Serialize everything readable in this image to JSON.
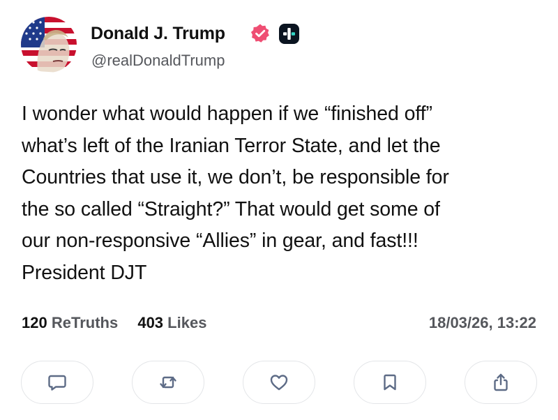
{
  "author": {
    "name": "Donald J. Trump",
    "handle": "@realDonaldTrump",
    "verified": true,
    "avatar_icon": "flag-portrait-avatar",
    "badge_icon": "plus-badge-icon"
  },
  "post": {
    "lines": [
      "I wonder what would happen if we “finished off”",
      "what’s left of the Iranian Terror State, and let the",
      "Countries that use it, we don’t, be responsible for",
      "the so called “Straight?” That would get some of",
      "our non-responsive “Allies” in gear, and fast!!!",
      "President DJT"
    ]
  },
  "stats": {
    "retruths_count": "120",
    "retruths_label": "ReTruths",
    "likes_count": "403",
    "likes_label": "Likes",
    "date": "18/03/26, 13:22"
  },
  "actions": [
    {
      "icon": "comment-icon"
    },
    {
      "icon": "retruth-icon"
    },
    {
      "icon": "heart-icon"
    },
    {
      "icon": "bookmark-icon"
    },
    {
      "icon": "share-icon"
    }
  ],
  "colors": {
    "verified_badge": "#ef4e73",
    "plus_badge": "#0b1420",
    "secondary_text": "#55575c",
    "border": "#e3e5e8",
    "icon_stroke": "#5d6b86"
  }
}
